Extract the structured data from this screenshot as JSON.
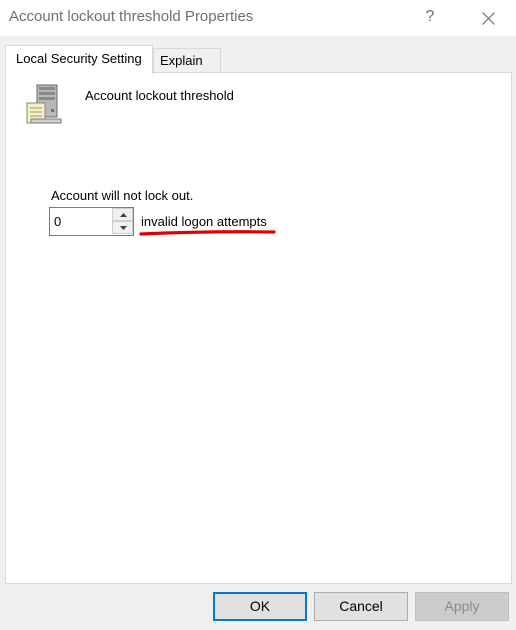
{
  "window": {
    "title": "Account lockout threshold Properties",
    "help_glyph": "?",
    "close_icon": "close-icon"
  },
  "tabs": [
    {
      "label": "Local Security Setting",
      "active": true
    },
    {
      "label": "Explain",
      "active": false
    }
  ],
  "policy": {
    "icon": "server-icon",
    "name": "Account lockout threshold"
  },
  "setting": {
    "description": "Account will not lock out.",
    "value": "0",
    "unit_label": "invalid logon attempts",
    "annotation_color": "#e00000"
  },
  "footer": {
    "ok_label": "OK",
    "cancel_label": "Cancel",
    "apply_label": "Apply",
    "apply_enabled": false
  },
  "colors": {
    "accent": "#0078d7",
    "highlight_underline": "#e00000"
  }
}
